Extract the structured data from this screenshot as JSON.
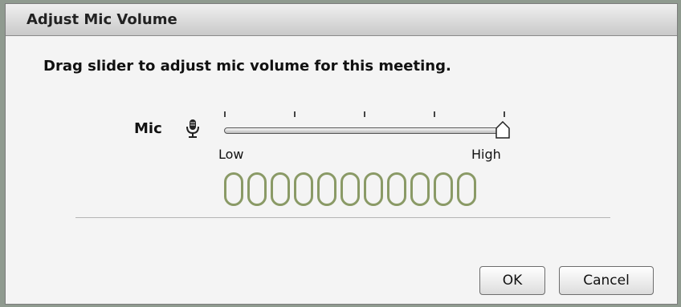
{
  "dialog": {
    "title": "Adjust Mic Volume",
    "instructions": "Drag slider to adjust mic volume for this meeting."
  },
  "mic": {
    "label": "Mic",
    "icon": "microphone-icon",
    "volume": 1.0,
    "low_label": "Low",
    "high_label": "High",
    "tick_count": 5
  },
  "level_meter": {
    "segments": 11,
    "active_segments": 0,
    "color": "#8a9a66"
  },
  "buttons": {
    "ok_label": "OK",
    "cancel_label": "Cancel"
  }
}
